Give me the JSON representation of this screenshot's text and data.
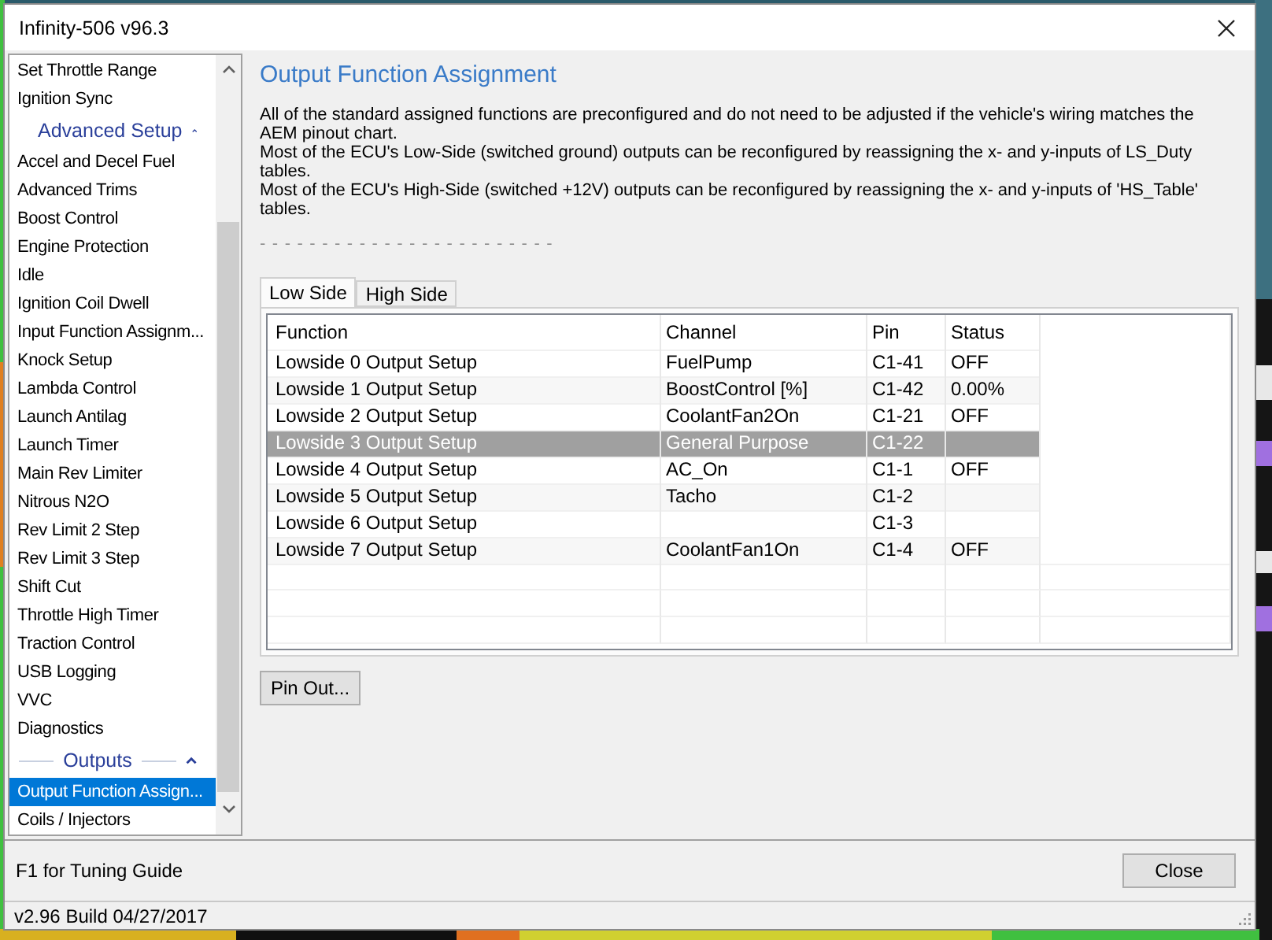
{
  "window": {
    "title": "Infinity-506 v96.3"
  },
  "sidebar": {
    "leading_items": [
      {
        "label": "Set Throttle Range",
        "selected": false
      },
      {
        "label": "Ignition Sync",
        "selected": false
      }
    ],
    "sections": [
      {
        "title": "Advanced Setup",
        "expanded": true,
        "items": [
          {
            "label": "Accel and Decel Fuel",
            "selected": false
          },
          {
            "label": "Advanced Trims",
            "selected": false
          },
          {
            "label": "Boost Control",
            "selected": false
          },
          {
            "label": "Engine Protection",
            "selected": false
          },
          {
            "label": "Idle",
            "selected": false
          },
          {
            "label": "Ignition Coil Dwell",
            "selected": false
          },
          {
            "label": "Input Function Assignm...",
            "selected": false
          },
          {
            "label": "Knock Setup",
            "selected": false
          },
          {
            "label": "Lambda Control",
            "selected": false
          },
          {
            "label": "Launch Antilag",
            "selected": false
          },
          {
            "label": "Launch Timer",
            "selected": false
          },
          {
            "label": "Main Rev Limiter",
            "selected": false
          },
          {
            "label": "Nitrous N2O",
            "selected": false
          },
          {
            "label": "Rev Limit 2 Step",
            "selected": false
          },
          {
            "label": "Rev Limit 3 Step",
            "selected": false
          },
          {
            "label": "Shift Cut",
            "selected": false
          },
          {
            "label": "Throttle High Timer",
            "selected": false
          },
          {
            "label": "Traction Control",
            "selected": false
          },
          {
            "label": "USB Logging",
            "selected": false
          },
          {
            "label": "VVC",
            "selected": false
          },
          {
            "label": "Diagnostics",
            "selected": false
          }
        ]
      },
      {
        "title": "Outputs",
        "expanded": true,
        "items": [
          {
            "label": "Output Function Assign...",
            "selected": true
          },
          {
            "label": "Coils / Injectors",
            "selected": false
          }
        ]
      }
    ]
  },
  "content": {
    "heading": "Output Function Assignment",
    "paragraphs": [
      "All of the standard assigned functions are preconfigured and do not need to be adjusted if the vehicle's wiring matches the AEM pinout chart.",
      "Most of the ECU's Low-Side (switched ground) outputs can be reconfigured by reassigning the x- and y-inputs of LS_Duty tables.",
      "Most of the ECU's High-Side (switched +12V) outputs can be reconfigured by reassigning the x- and y-inputs of 'HS_Table' tables."
    ],
    "divider_text": "- - - - - - - - - - - - - - - - - - - - - - - -",
    "tabs": [
      {
        "label": "Low Side",
        "selected": true
      },
      {
        "label": "High Side",
        "selected": false
      }
    ],
    "table": {
      "columns": [
        "Function",
        "Channel",
        "Pin",
        "Status"
      ],
      "rows": [
        {
          "function": "Lowside 0 Output Setup",
          "channel": "FuelPump",
          "pin": "C1-41",
          "status": "OFF",
          "selected": false
        },
        {
          "function": "Lowside 1 Output Setup",
          "channel": "BoostControl [%]",
          "pin": "C1-42",
          "status": "0.00%",
          "selected": false
        },
        {
          "function": "Lowside 2 Output Setup",
          "channel": "CoolantFan2On",
          "pin": "C1-21",
          "status": "OFF",
          "selected": false
        },
        {
          "function": "Lowside 3 Output Setup",
          "channel": "General Purpose",
          "pin": "C1-22",
          "selected": true
        },
        {
          "function": "Lowside 4 Output Setup",
          "channel": "AC_On",
          "pin": "C1-1",
          "status": "OFF",
          "selected": false
        },
        {
          "function": "Lowside 5 Output Setup",
          "channel": "Tacho",
          "pin": "C1-2",
          "selected": false
        },
        {
          "function": "Lowside 6 Output Setup",
          "pin": "C1-3",
          "selected": false
        },
        {
          "function": "Lowside 7 Output Setup",
          "channel": "CoolantFan1On",
          "pin": "C1-4",
          "status": "OFF",
          "selected": false
        }
      ]
    },
    "pin_out_button": "Pin Out..."
  },
  "footer": {
    "hint": "F1 for Tuning Guide",
    "close_button": "Close"
  },
  "status_bar": {
    "version": "v2.96 Build 04/27/2017"
  }
}
